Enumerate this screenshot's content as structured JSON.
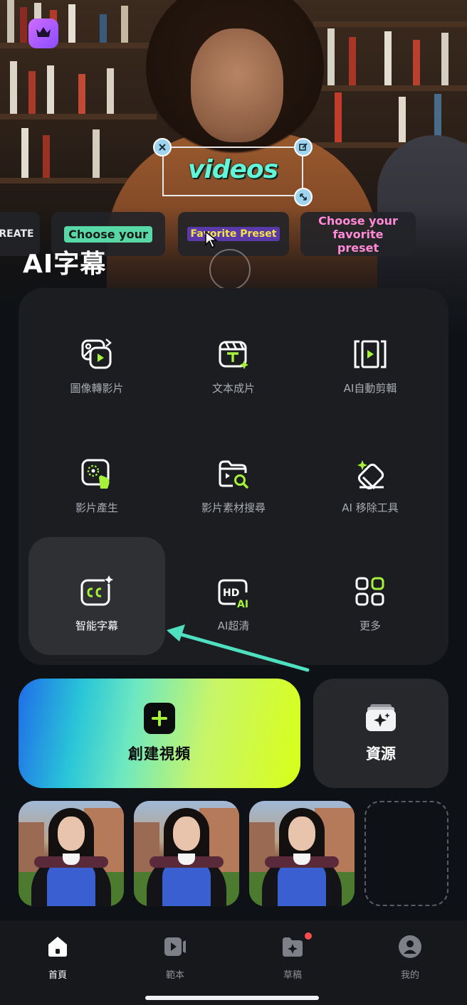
{
  "hero": {
    "title": "AI字幕",
    "sticker_text": "videos",
    "presets": [
      {
        "text": "REATE",
        "color": "#e8e8e8"
      },
      {
        "text": "Choose your",
        "color": "#1a1a1a",
        "bg": "#57d8a6"
      },
      {
        "text": "Favorite Preset",
        "color": "#f5e24a",
        "bg": "#5a3aa8"
      },
      {
        "text": "Choose your favorite preset",
        "color": "#ff8ad8"
      }
    ],
    "crown_icon": "crown-icon"
  },
  "tools": [
    {
      "label": "圖像轉影片",
      "icon": "image-to-video-icon"
    },
    {
      "label": "文本成片",
      "icon": "text-to-video-icon"
    },
    {
      "label": "AI自動剪輯",
      "icon": "auto-cut-icon"
    },
    {
      "label": "影片產生",
      "icon": "video-generate-icon"
    },
    {
      "label": "影片素材搜尋",
      "icon": "footage-search-icon"
    },
    {
      "label": "AI 移除工具",
      "icon": "eraser-icon"
    },
    {
      "label": "智能字幕",
      "icon": "captions-cc-icon"
    },
    {
      "label": "AI超清",
      "icon": "hd-ai-icon"
    },
    {
      "label": "更多",
      "icon": "more-grid-icon"
    }
  ],
  "actions": {
    "create_label": "創建視頻",
    "resources_label": "資源"
  },
  "nav": {
    "items": [
      {
        "label": "首頁",
        "icon": "home-icon",
        "active": true
      },
      {
        "label": "範本",
        "icon": "template-icon",
        "active": false
      },
      {
        "label": "草稿",
        "icon": "drafts-icon",
        "active": false
      },
      {
        "label": "我的",
        "icon": "profile-icon",
        "active": false
      }
    ]
  },
  "colors": {
    "accent_green": "#a6f23a",
    "highlight_arrow": "#4fe0c0",
    "notification": "#ff4d4d"
  }
}
